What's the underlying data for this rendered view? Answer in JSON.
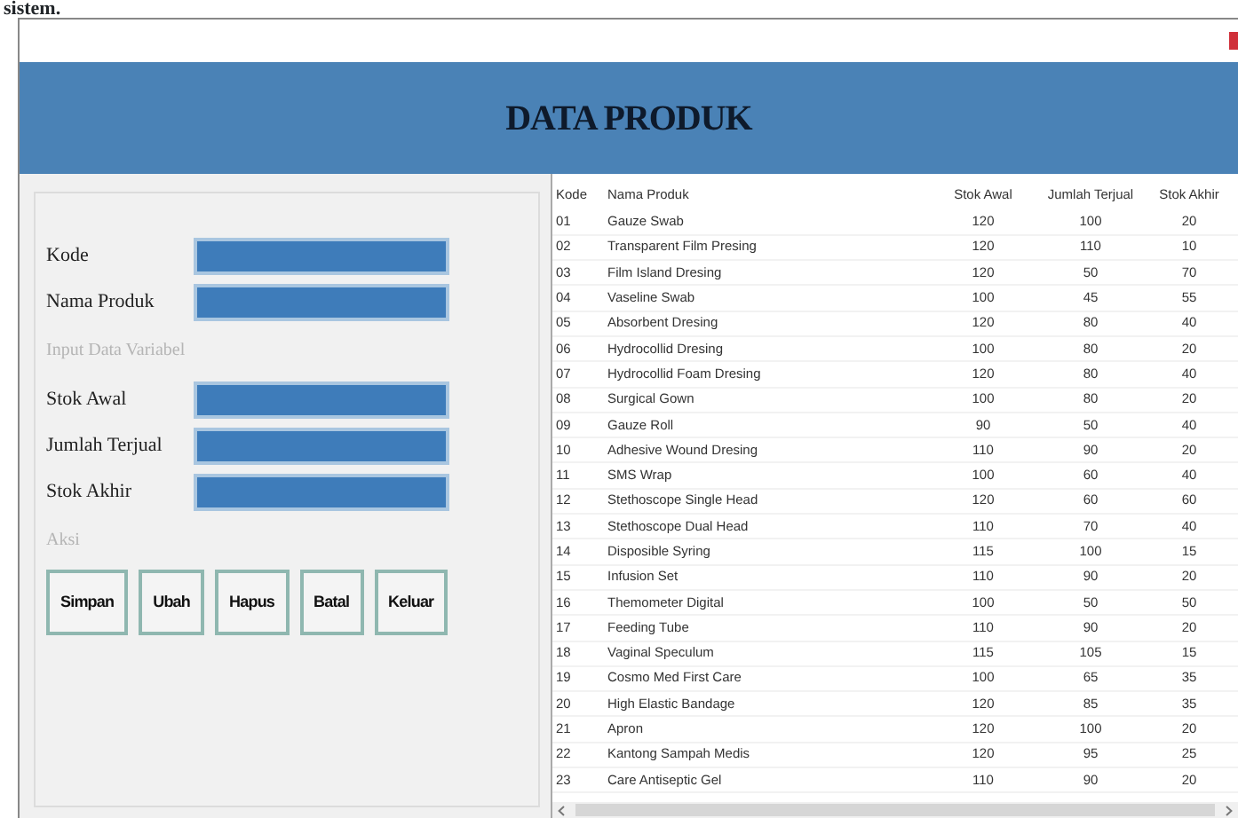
{
  "caption": "sistem.",
  "header": {
    "title": "DATA PRODUK"
  },
  "form": {
    "items": [
      {
        "kind": "field",
        "label": "Kode"
      },
      {
        "kind": "field",
        "label": "Nama Produk"
      },
      {
        "kind": "section",
        "label": "Input Data Variabel"
      },
      {
        "kind": "field",
        "label": "Stok Awal"
      },
      {
        "kind": "field",
        "label": "Jumlah Terjual"
      },
      {
        "kind": "field",
        "label": "Stok Akhir"
      },
      {
        "kind": "section",
        "label": "Aksi"
      }
    ],
    "buttons": [
      "Simpan",
      "Ubah",
      "Hapus",
      "Batal",
      "Keluar"
    ]
  },
  "table": {
    "columns": [
      "Kode",
      "Nama Produk",
      "Stok Awal",
      "Jumlah Terjual",
      "Stok Akhir"
    ],
    "rows": [
      [
        "01",
        "Gauze Swab",
        "120",
        "100",
        "20"
      ],
      [
        "02",
        "Transparent Film Presing",
        "120",
        "110",
        "10"
      ],
      [
        "03",
        "Film Island Dresing",
        "120",
        "50",
        "70"
      ],
      [
        "04",
        "Vaseline Swab",
        "100",
        "45",
        "55"
      ],
      [
        "05",
        "Absorbent Dresing",
        "120",
        "80",
        "40"
      ],
      [
        "06",
        "Hydrocollid Dresing",
        "100",
        "80",
        "20"
      ],
      [
        "07",
        "Hydrocollid Foam Dresing",
        "120",
        "80",
        "40"
      ],
      [
        "08",
        "Surgical Gown",
        "100",
        "80",
        "20"
      ],
      [
        "09",
        "Gauze Roll",
        "90",
        "50",
        "40"
      ],
      [
        "10",
        "Adhesive Wound Dresing",
        "110",
        "90",
        "20"
      ],
      [
        "11",
        "SMS Wrap",
        "100",
        "60",
        "40"
      ],
      [
        "12",
        "Stethoscope Single Head",
        "120",
        "60",
        "60"
      ],
      [
        "13",
        "Stethoscope Dual Head",
        "110",
        "70",
        "40"
      ],
      [
        "14",
        "Disposible Syring",
        "115",
        "100",
        "15"
      ],
      [
        "15",
        "Infusion Set",
        "110",
        "90",
        "20"
      ],
      [
        "16",
        "Themometer Digital",
        "100",
        "50",
        "50"
      ],
      [
        "17",
        "Feeding Tube",
        "110",
        "90",
        "20"
      ],
      [
        "18",
        "Vaginal Speculum",
        "115",
        "105",
        "15"
      ],
      [
        "19",
        "Cosmo Med First Care",
        "100",
        "65",
        "35"
      ],
      [
        "20",
        "High Elastic Bandage",
        "120",
        "85",
        "35"
      ],
      [
        "21",
        "Apron",
        "120",
        "100",
        "20"
      ],
      [
        "22",
        "Kantong Sampah Medis",
        "120",
        "95",
        "25"
      ],
      [
        "23",
        "Care Antiseptic Gel",
        "110",
        "90",
        "20"
      ]
    ]
  }
}
